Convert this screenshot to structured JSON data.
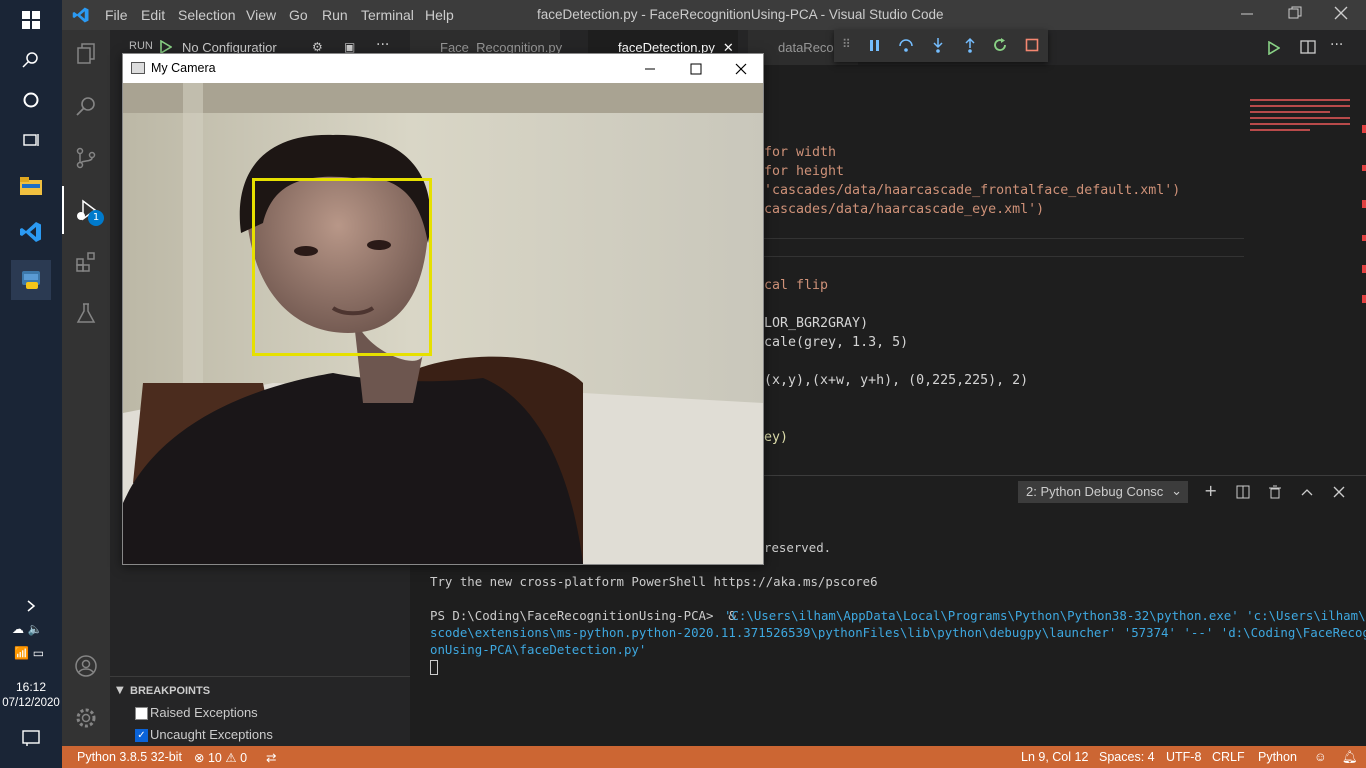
{
  "taskbar": {
    "clock_time": "16:12",
    "clock_date": "07/12/2020"
  },
  "titlebar": {
    "title": "faceDetection.py - FaceRecognitionUsing-PCA - Visual Studio Code",
    "menus": [
      "File",
      "Edit",
      "Selection",
      "View",
      "Go",
      "Run",
      "Terminal",
      "Help"
    ]
  },
  "sidebar": {
    "run_label": "RUN",
    "config_label": "No Configuratior",
    "breakpoints_header": "BREAKPOINTS",
    "breakpoints": [
      {
        "label": "Raised Exceptions",
        "checked": false
      },
      {
        "label": "Uncaught Exceptions",
        "checked": true
      }
    ]
  },
  "activity": {
    "debug_badge": "1"
  },
  "tabs": [
    {
      "label": "Face_Recognition.py"
    },
    {
      "label": "faceDetection.py"
    },
    {
      "label": "dataRecor"
    }
  ],
  "editor": {
    "lines": [
      "for width",
      "for height",
      "'cascades/data/haarcascade_frontalface_default.xml')",
      "cascades/data/haarcascade_eye.xml')",
      "cal flip",
      "LOR_BGR2GRAY)",
      "cale(grey, 1.3, 5)",
      "(x,y),(x+w, y+h), (0,225,225), 2)",
      "ey)"
    ]
  },
  "panel": {
    "dropdown": "2: Python Debug Consc",
    "terminal_lines": [
      "reserved.",
      "Try the new cross-platform PowerShell https://aka.ms/pscore6",
      "PS D:\\Coding\\FaceRecognitionUsing-PCA>  & ",
      "'C:\\Users\\ilham\\AppData\\Local\\Programs\\Python\\Python38-32\\python.exe' 'c:\\Users\\ilham\\.v",
      "scode\\extensions\\ms-python.python-2020.11.371526539\\pythonFiles\\lib\\python\\debugpy\\launcher' '57374' '--' 'd:\\Coding\\FaceRecogniti",
      "onUsing-PCA\\faceDetection.py'"
    ]
  },
  "camera": {
    "title": "My Camera"
  },
  "statusbar": {
    "python": "Python 3.8.5 32-bit",
    "errors": "10",
    "warnings": "0",
    "position": "Ln 9, Col 12",
    "spaces": "Spaces: 4",
    "encoding": "UTF-8",
    "eol": "CRLF",
    "language": "Python"
  },
  "colors": {
    "statusbar": "#cc6633",
    "face_box": "#e6e000"
  }
}
